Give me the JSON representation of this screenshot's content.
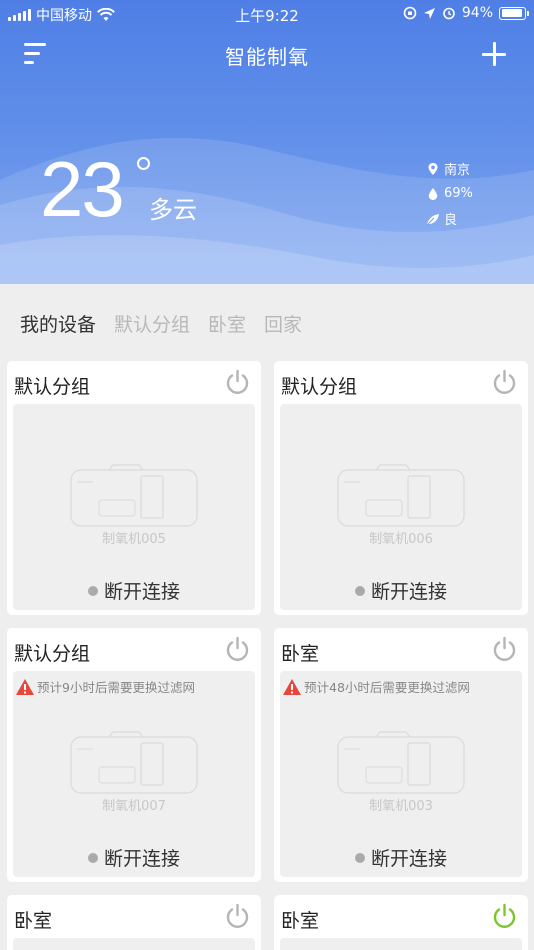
{
  "status_bar": {
    "carrier": "中国移动",
    "time": "上午9:22",
    "battery": "94%",
    "battery_level": 0.94
  },
  "nav": {
    "title": "智能制氧",
    "menu_icon": "menu-icon",
    "add_icon": "plus-icon"
  },
  "weather": {
    "temperature": "23",
    "condition": "多云",
    "city": "南京",
    "humidity": "69%",
    "air_quality": "良"
  },
  "tabs": [
    {
      "label": "我的设备",
      "active": true
    },
    {
      "label": "默认分组",
      "active": false
    },
    {
      "label": "卧室",
      "active": false
    },
    {
      "label": "回家",
      "active": false
    }
  ],
  "devices": [
    {
      "group": "默认分组",
      "name": "制氧机005",
      "status": "断开连接",
      "warning": "",
      "power_on": false
    },
    {
      "group": "默认分组",
      "name": "制氧机006",
      "status": "断开连接",
      "warning": "",
      "power_on": false
    },
    {
      "group": "默认分组",
      "name": "制氧机007",
      "status": "断开连接",
      "warning": "预计9小时后需要更换过滤网",
      "power_on": false
    },
    {
      "group": "卧室",
      "name": "制氧机003",
      "status": "断开连接",
      "warning": "预计48小时后需要更换过滤网",
      "power_on": false
    },
    {
      "group": "卧室",
      "name": "",
      "status": "",
      "warning": "",
      "power_on": false
    },
    {
      "group": "卧室",
      "name": "",
      "status": "",
      "warning": "",
      "power_on": true
    }
  ],
  "colors": {
    "header_top": "#4f7fe6",
    "header_bottom": "#83a9f0",
    "power_off": "#b5b5b5",
    "power_on": "#7cc62b",
    "warning": "#e8463a",
    "status_dot": "#aaaaaa"
  }
}
